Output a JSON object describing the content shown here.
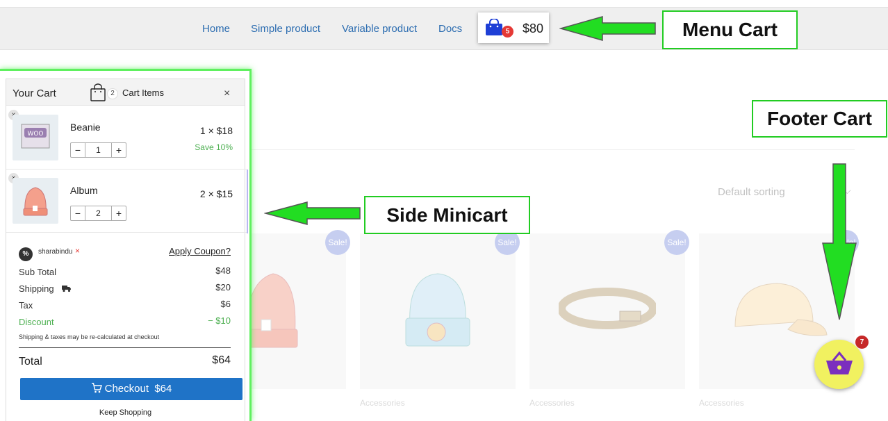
{
  "nav": {
    "links": [
      "Home",
      "Simple product",
      "Variable product",
      "Docs"
    ],
    "menu_cart": {
      "count": "5",
      "amount": "$80"
    }
  },
  "annotations": {
    "menu_cart": "Menu Cart",
    "footer_cart": "Footer Cart",
    "side_minicart": "Side Minicart"
  },
  "shop": {
    "sorting": "Default sorting",
    "sale_label": "Sale!",
    "category": "Accessories"
  },
  "minicart": {
    "title": "Your Cart",
    "count": "2",
    "items_label": "Cart Items",
    "close": "×",
    "remove": "×",
    "items": [
      {
        "name": "Beanie",
        "qty": "1",
        "price": "1 × $18",
        "save": "Save 10%"
      },
      {
        "name": "Album",
        "qty": "2",
        "price": "2 × $15",
        "save": ""
      }
    ],
    "qty_minus": "−",
    "qty_plus": "+",
    "coupon_icon": "%",
    "coupon_code": "sharabindu",
    "coupon_remove": "×",
    "apply_coupon": "Apply Coupon?",
    "rows": [
      {
        "label": "Sub Total",
        "value": "$48"
      },
      {
        "label": "Shipping",
        "value": "$20"
      },
      {
        "label": "Tax",
        "value": "$6"
      },
      {
        "label": "Discount",
        "value": "− $10"
      }
    ],
    "note": "Shipping & taxes may be re-calculated at checkout",
    "total_label": "Total",
    "total_value": "$64",
    "checkout_label": "Checkout",
    "checkout_amount": "$64",
    "keep_shopping": "Keep Shopping"
  },
  "footer_cart": {
    "count": "7"
  },
  "colors": {
    "accent": "#1f73c7",
    "discount": "#4caf50",
    "callout_border": "#22cc22",
    "footer_cart_bg": "#f1f160",
    "footer_basket": "#7b2fbe",
    "badge_red": "#e53935"
  },
  "icons": [
    "shopping-bag-icon",
    "cart-icon",
    "truck-icon",
    "basket-icon",
    "close-icon",
    "coupon-icon",
    "arrow-left-icon",
    "arrow-down-icon"
  ]
}
